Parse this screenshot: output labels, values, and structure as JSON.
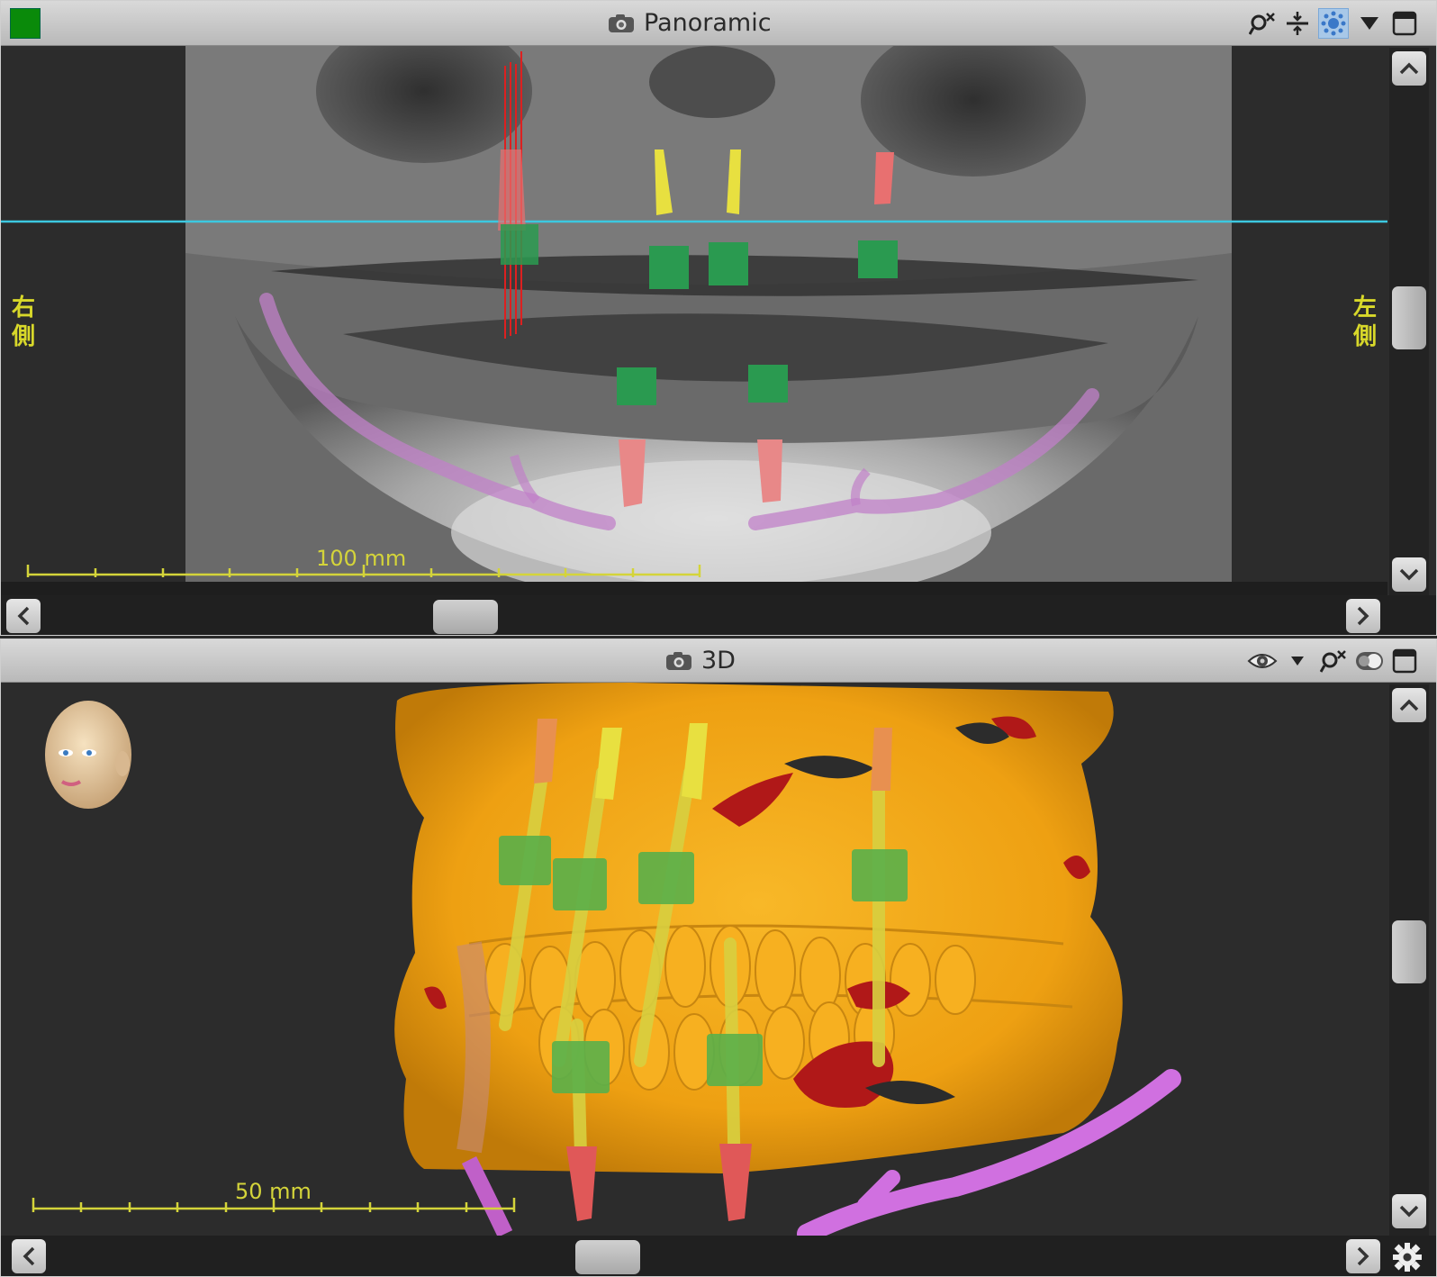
{
  "panoramic": {
    "title": "Panoramic",
    "side_right_label": "右側",
    "side_left_label": "左側",
    "scale_label": "100 mm",
    "icons": [
      "green-status-square",
      "camera-icon",
      "reset-view-icon",
      "split-icon",
      "render-settings-icon",
      "dropdown-icon",
      "maximize-icon"
    ]
  },
  "view3d": {
    "title": "3D",
    "scale_label": "50 mm",
    "icons": [
      "camera-icon",
      "eye-icon",
      "dropdown-icon",
      "reset-view-icon",
      "toggle-icon",
      "maximize-icon",
      "settings-gear-icon"
    ]
  },
  "colors": {
    "accent_cyan": "#3cc8e0",
    "scale_yellow": "#d4d43a",
    "implant_yellow": "#e8e040",
    "implant_red": "#e87070",
    "sleeve_green": "#2a9a50",
    "nerve_pink": "#c080c8",
    "bone_orange": "#f2a818",
    "blood_red": "#b01818"
  }
}
